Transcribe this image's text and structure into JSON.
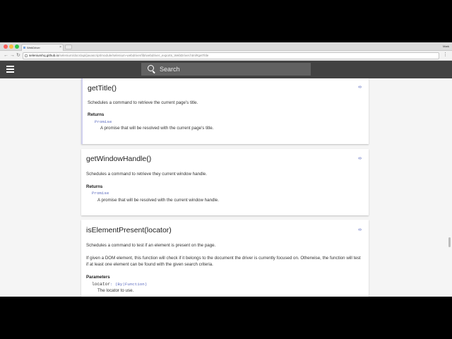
{
  "browser": {
    "tab_title": "WebDriver",
    "tab_close": "×",
    "profile": "Mark",
    "nav": {
      "back": "←",
      "forward": "→",
      "reload": "↻"
    },
    "url_host": "seleniumhq.github.io",
    "url_path": "/selenium/docs/api/javascript/module/selenium-webdriver/lib/webdriver_exports_WebDriver.html#getTitle",
    "menu": "⋮"
  },
  "header": {
    "search_placeholder": "Search"
  },
  "methods": [
    {
      "title": "getTitle()",
      "toggle": "‹›",
      "description": "Schedules a command to retrieve the current page's title.",
      "returns_label": "Returns",
      "return_type": "Promise",
      "return_desc": "A promise that will be resolved with the current page's title."
    },
    {
      "title": "getWindowHandle()",
      "toggle": "‹›",
      "description": "Schedules a command to retrieve they current window handle.",
      "returns_label": "Returns",
      "return_type": "Promise",
      "return_desc": "A promise that will be resolved with the current window handle."
    },
    {
      "title": "isElementPresent(locator)",
      "toggle": "‹›",
      "description": "Schedules a command to test if an element is present on the page.",
      "description2": "If given a DOM element, this function will check if it belongs to the document the driver is currently focused on. Otherwise, the function will test if at least one element can be found with the given search criteria.",
      "params_label": "Parameters",
      "param_name": "locator",
      "param_type": ": (By|Function)",
      "param_desc": "The locator to use."
    }
  ]
}
